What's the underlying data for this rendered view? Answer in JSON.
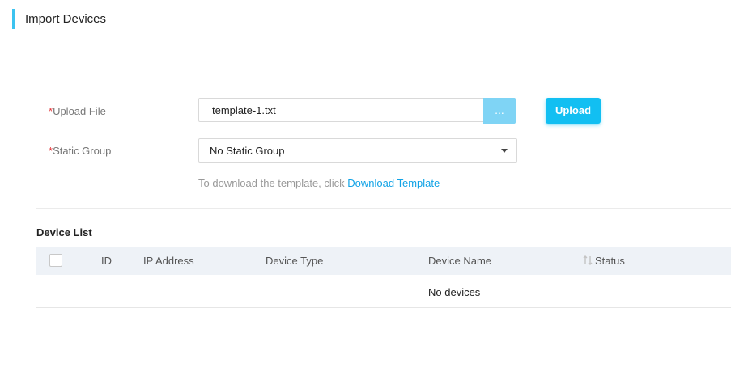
{
  "header": {
    "title": "Import Devices",
    "accent_color": "#3cc3f0"
  },
  "form": {
    "upload_file": {
      "required_mark": "*",
      "label": "Upload File",
      "value": "template-1.txt",
      "browse_label": "...",
      "upload_button": "Upload"
    },
    "static_group": {
      "required_mark": "*",
      "label": "Static Group",
      "selected": "No Static Group"
    },
    "hint": {
      "text": "To download the template, click ",
      "link": "Download Template"
    }
  },
  "device_list": {
    "title": "Device List",
    "columns": [
      "ID",
      "IP Address",
      "Device Type",
      "Device Name",
      "Status"
    ],
    "sortable_icon": "sort-icon",
    "rows": [],
    "empty_message": "No devices"
  },
  "colors": {
    "primary": "#12bff2",
    "link": "#12a3e6",
    "required": "#e4393c",
    "table_header_bg": "#eef2f7"
  }
}
